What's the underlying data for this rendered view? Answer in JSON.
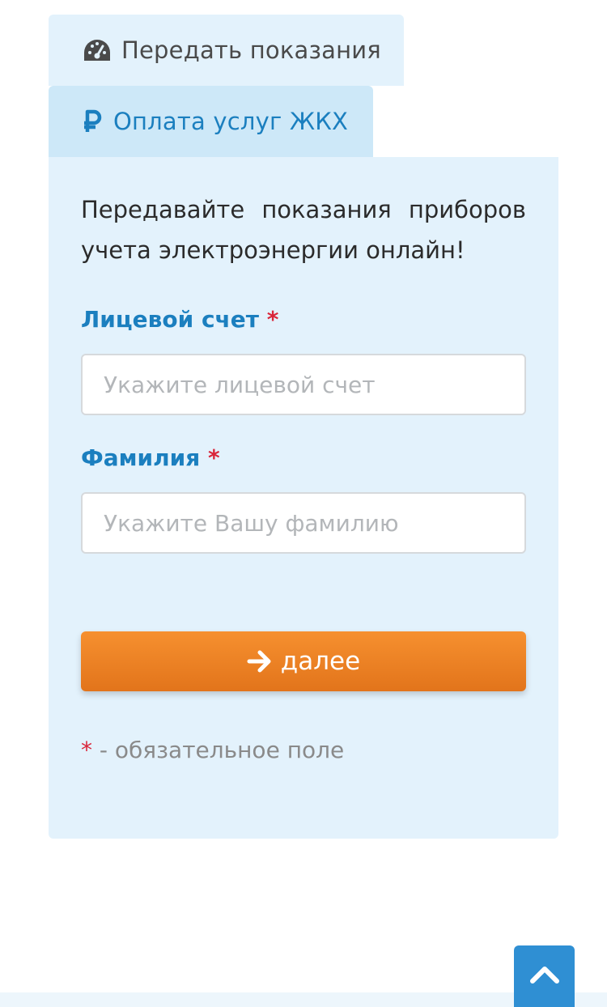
{
  "tabs": {
    "meter": {
      "label": "Передать показания",
      "icon": "gauge-icon"
    },
    "payment": {
      "label": "Оплата услуг ЖКХ",
      "icon": "ruble-icon"
    }
  },
  "form": {
    "intro": "Передавайте показания приборов учета электроэнергии онлайн!",
    "account": {
      "label": "Лицевой счет",
      "required_mark": "*",
      "placeholder": "Укажите лицевой счет",
      "value": ""
    },
    "surname": {
      "label": "Фамилия",
      "required_mark": "*",
      "placeholder": "Укажите Вашу фамилию",
      "value": ""
    },
    "submit_label": "далее",
    "required_note_mark": "*",
    "required_note": " - обязательное поле"
  },
  "colors": {
    "accent": "#1b7fbf",
    "button": "#f08326",
    "required": "#d9263a",
    "panel_bg": "#e3f2fc"
  }
}
